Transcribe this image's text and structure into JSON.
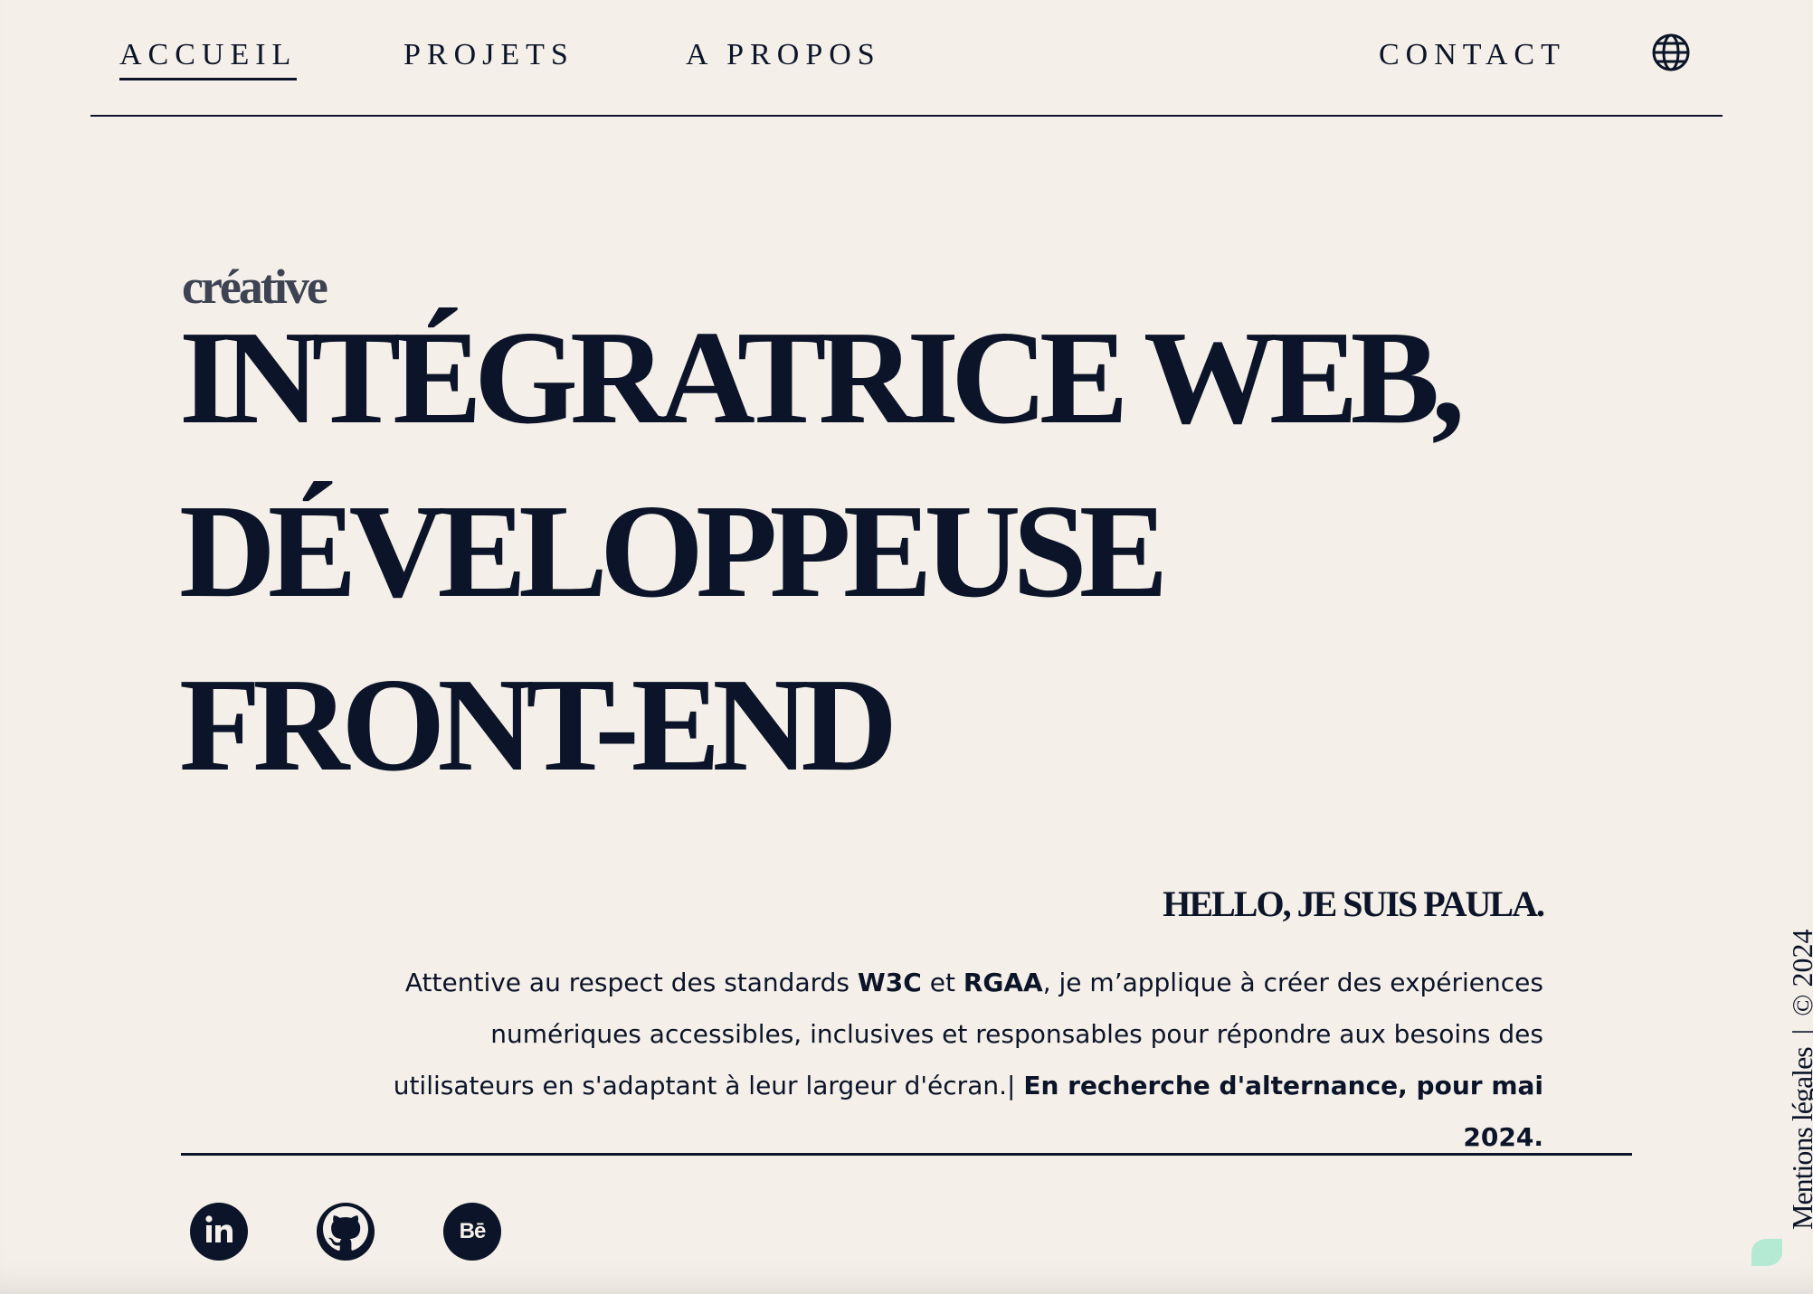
{
  "nav": {
    "links": [
      {
        "label": "ACCUEIL",
        "active": true
      },
      {
        "label": "PROJETS",
        "active": false
      },
      {
        "label": "A PROPOS",
        "active": false
      }
    ],
    "contact_label": "CONTACT",
    "language_icon": "globe-icon"
  },
  "hero": {
    "kicker": "créative",
    "headline": "INTÉGRATRICE WEB, DÉVELOPPEUSE FRONT-END"
  },
  "intro": {
    "title": "HELLO, JE SUIS PAULA.",
    "text_1": "Attentive au respect des standards ",
    "w3c": "W3C",
    "text_2": " et ",
    "rgaa": "RGAA",
    "text_3": ", je m’applique à créer des expériences numériques accessibles, inclusives et responsables pour répondre aux besoins des utilisateurs en s'adaptant à leur largeur d'écran.| ",
    "highlight": "En recherche d'alternance, pour mai 2024."
  },
  "socials": [
    {
      "name": "linkedin",
      "icon": "linkedin-icon"
    },
    {
      "name": "github",
      "icon": "github-icon"
    },
    {
      "name": "behance",
      "icon": "behance-icon",
      "glyph": "Bē"
    }
  ],
  "footer_side": {
    "legal_label": "Mentions légales",
    "separator": "|",
    "copyright": "© 2024"
  },
  "colors": {
    "background": "#f5efe9",
    "ink": "#0b1428",
    "accent_leaf": "#b4ead3"
  }
}
